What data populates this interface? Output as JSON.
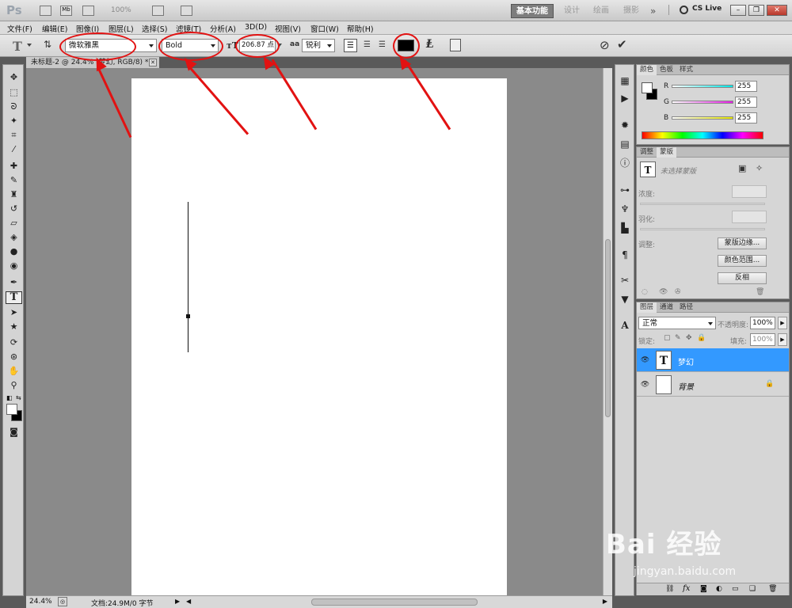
{
  "appbar": {
    "logo": "Ps",
    "zoom": "100%",
    "workspaces": [
      "基本功能",
      "设计",
      "绘画",
      "摄影"
    ],
    "more": "»",
    "cslive": "CS Live"
  },
  "menu": [
    "文件(F)",
    "编辑(E)",
    "图像(I)",
    "图层(L)",
    "选择(S)",
    "滤镜(T)",
    "分析(A)",
    "3D(D)",
    "视图(V)",
    "窗口(W)",
    "帮助(H)"
  ],
  "options": {
    "font_family": "微软雅黑",
    "font_style": "Bold",
    "font_size": "206.87 点",
    "aa_icon": "aa",
    "antialias": "锐利",
    "color_hex": "#000000"
  },
  "document": {
    "tab_title": "未标题-2 @ 24.4% (梦幻, RGB/8) *",
    "zoom": "24.4%",
    "status": "文档:24.9M/0 字节"
  },
  "color_panel": {
    "tabs": [
      "颜色",
      "色板",
      "样式"
    ],
    "r_label": "R",
    "g_label": "G",
    "b_label": "B",
    "r": "255",
    "g": "255",
    "b": "255",
    "r_color": "#00e5e5",
    "g_color": "#e51ce5",
    "b_color": "#e5e500"
  },
  "masks_panel": {
    "tabs": [
      "调整",
      "蒙版"
    ],
    "no_mask": "未选择蒙版",
    "density": "浓度:",
    "feather": "羽化:",
    "refine": "调整:",
    "mask_edge": "蒙版边缘...",
    "color_range": "颜色范围...",
    "invert": "反相"
  },
  "layers_panel": {
    "tabs": [
      "图层",
      "通道",
      "路径"
    ],
    "blend_mode": "正常",
    "opacity_label": "不透明度:",
    "opacity": "100%",
    "lock_label": "锁定:",
    "fill_label": "填充:",
    "fill": "100%",
    "layers": [
      {
        "name": "梦幻",
        "thumb": "T",
        "selected": true
      },
      {
        "name": "背景",
        "thumb": "",
        "selected": false
      }
    ],
    "selected_color": "#3399ff"
  },
  "watermark": {
    "brand": "Bai 经验",
    "url": "jingyan.baidu.com"
  },
  "annotation_color": "#e21212"
}
